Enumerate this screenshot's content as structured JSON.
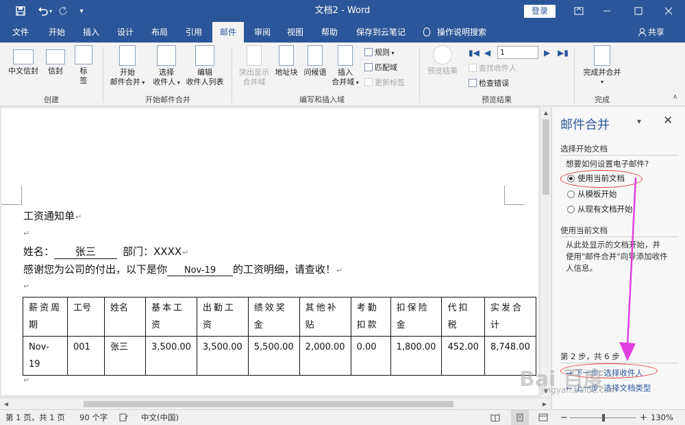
{
  "titlebar": {
    "doc_title": "文档2 - Word",
    "login": "登录",
    "save_icon": "save-icon",
    "undo_icon": "undo-icon",
    "redo_icon": "redo-icon",
    "customize_icon": "customize-qat-icon"
  },
  "tabs": [
    "文件",
    "开始",
    "插入",
    "设计",
    "布局",
    "引用",
    "邮件",
    "审阅",
    "视图",
    "帮助",
    "保存到云笔记"
  ],
  "active_tab": "邮件",
  "tell_me": "操作说明搜索",
  "share": "共享",
  "ribbon": {
    "create": {
      "label": "创建",
      "envelope_cn": "中文信封",
      "envelope": "信封",
      "label_btn_1": "标",
      "label_btn_2": "签"
    },
    "start_merge": {
      "label": "开始邮件合并",
      "start_1": "开始",
      "start_2": "邮件合并",
      "select_1": "选择",
      "select_2": "收件人",
      "edit_1": "编辑",
      "edit_2": "收件人列表"
    },
    "write_insert": {
      "label": "编写和插入域",
      "highlight_1": "突出显示",
      "highlight_2": "合并域",
      "address_block": "地址块",
      "greeting": "问候语",
      "insert_1": "插入",
      "insert_2": "合并域",
      "rules": "规则",
      "match_fields": "匹配域",
      "update_labels": "更新标签"
    },
    "preview": {
      "label": "预览结果",
      "preview_results": "预览结果",
      "record_value": "1",
      "find_recipient": "查找收件人",
      "check_errors": "检查错误"
    },
    "finish": {
      "label": "完成",
      "finish_merge": "完成并合并"
    }
  },
  "document": {
    "title": "工资通知单",
    "name_label": "姓名：",
    "name_value": "张三",
    "dept_label": "部门：XXXX",
    "thanks_prefix": "感谢您为公司的付出，以下是你",
    "month_value": "Nov-19",
    "thanks_suffix": "的工资明细，请查收！",
    "table_headers": [
      [
        "薪资周",
        "期"
      ],
      [
        "工号",
        ""
      ],
      [
        "姓名",
        ""
      ],
      [
        "基本工",
        "资"
      ],
      [
        "出勤工",
        "资"
      ],
      [
        "绩效奖",
        "金"
      ],
      [
        "其他补",
        "贴"
      ],
      [
        "考勤",
        "扣款"
      ],
      [
        "扣保险",
        "金"
      ],
      [
        "代扣",
        "税"
      ],
      [
        "实发合",
        "计"
      ]
    ],
    "table_row": [
      [
        "Nov-",
        "19"
      ],
      [
        "001",
        ""
      ],
      [
        "张三",
        ""
      ],
      [
        "3,500.00",
        ""
      ],
      [
        "3,500.00",
        ""
      ],
      [
        "5,500.00",
        ""
      ],
      [
        "2,000.00",
        ""
      ],
      [
        "0.00",
        ""
      ],
      [
        "1,800.00",
        ""
      ],
      [
        "452.00",
        ""
      ],
      [
        "8,748.00",
        ""
      ]
    ]
  },
  "pane": {
    "title": "邮件合并",
    "section1": "选择开始文档",
    "question": "想要如何设置电子邮件?",
    "opt1": "使用当前文档",
    "opt2": "从模板开始",
    "opt3": "从现有文档开始",
    "section2": "使用当前文档",
    "desc1": "从此处显示的文档开始，并",
    "desc2": "使用\"邮件合并\"向导添加收件",
    "desc3": "人信息。",
    "step": "第 2 步，共 6 步",
    "next": "下一步: 选择收件人",
    "prev": "上一步: 选择文档类型"
  },
  "status": {
    "page": "第 1 页，共 1 页",
    "words": "90 个字",
    "lang": "中文(中国)",
    "zoom": "130%"
  },
  "watermark": {
    "brand": "Bai 百度",
    "sub": "jingyan.baidu.com"
  },
  "colors": {
    "brand": "#2b579a",
    "annotation": "#e03a3a",
    "arrow": "#e040e0"
  }
}
